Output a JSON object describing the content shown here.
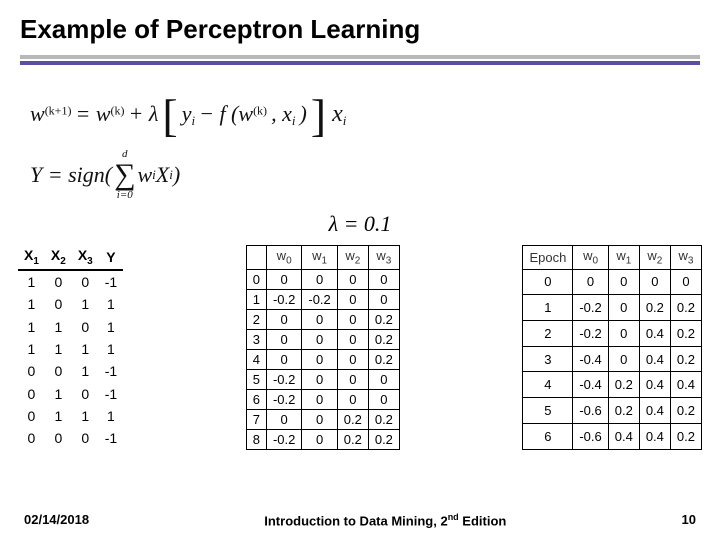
{
  "title": "Example of Perceptron Learning",
  "formula1_a": "w",
  "formula1_a_sup": "(k+1)",
  "formula1_eq": " = ",
  "formula1_b": "w",
  "formula1_b_sup": "(k)",
  "formula1_plus": " + λ",
  "formula1_inner_pre": "y",
  "formula1_inner_pre_sub": "i",
  "formula1_inner_mid": " − f (w",
  "formula1_inner_mid_sup": "(k)",
  "formula1_inner_post": ", x",
  "formula1_inner_post_sub": "i",
  "formula1_inner_close": " )",
  "formula1_tail": "x",
  "formula1_tail_sub": "i",
  "formula2_lead": "Y = sign(",
  "formula2_sum_top": "d",
  "formula2_sigma": "∑",
  "formula2_sum_bot": "i=0",
  "formula2_body_wa": "w",
  "formula2_body_wa_sub": "i",
  "formula2_body_xa": "X",
  "formula2_body_xa_sub": "i",
  "formula2_close": ")",
  "lambda_text": "λ = 0.1",
  "tbl_data": {
    "headers": [
      "X",
      "X",
      "X",
      "Y"
    ],
    "header_subs": [
      "1",
      "2",
      "3",
      ""
    ],
    "rows": [
      [
        "1",
        "0",
        "0",
        "-1"
      ],
      [
        "1",
        "0",
        "1",
        "1"
      ],
      [
        "1",
        "1",
        "0",
        "1"
      ],
      [
        "1",
        "1",
        "1",
        "1"
      ],
      [
        "0",
        "0",
        "1",
        "-1"
      ],
      [
        "0",
        "1",
        "0",
        "-1"
      ],
      [
        "0",
        "1",
        "1",
        "1"
      ],
      [
        "0",
        "0",
        "0",
        "-1"
      ]
    ]
  },
  "tbl_iter": {
    "headers": [
      "",
      "w",
      "w",
      "w",
      "w"
    ],
    "header_subs": [
      "",
      "0",
      "1",
      "2",
      "3"
    ],
    "rows": [
      [
        "0",
        "0",
        "0",
        "0",
        "0"
      ],
      [
        "1",
        "-0.2",
        "-0.2",
        "0",
        "0"
      ],
      [
        "2",
        "0",
        "0",
        "0",
        "0.2"
      ],
      [
        "3",
        "0",
        "0",
        "0",
        "0.2"
      ],
      [
        "4",
        "0",
        "0",
        "0",
        "0.2"
      ],
      [
        "5",
        "-0.2",
        "0",
        "0",
        "0"
      ],
      [
        "6",
        "-0.2",
        "0",
        "0",
        "0"
      ],
      [
        "7",
        "0",
        "0",
        "0.2",
        "0.2"
      ],
      [
        "8",
        "-0.2",
        "0",
        "0.2",
        "0.2"
      ]
    ]
  },
  "tbl_epoch": {
    "headers": [
      "Epoch",
      "w",
      "w",
      "w",
      "w"
    ],
    "header_subs": [
      "",
      "0",
      "1",
      "2",
      "3"
    ],
    "rows": [
      [
        "0",
        "0",
        "0",
        "0",
        "0"
      ],
      [
        "1",
        "-0.2",
        "0",
        "0.2",
        "0.2"
      ],
      [
        "2",
        "-0.2",
        "0",
        "0.4",
        "0.2"
      ],
      [
        "3",
        "-0.4",
        "0",
        "0.4",
        "0.2"
      ],
      [
        "4",
        "-0.4",
        "0.2",
        "0.4",
        "0.4"
      ],
      [
        "5",
        "-0.6",
        "0.2",
        "0.4",
        "0.2"
      ],
      [
        "6",
        "-0.6",
        "0.4",
        "0.4",
        "0.2"
      ]
    ]
  },
  "footer": {
    "date": "02/14/2018",
    "center_a": "Introduction to Data Mining, 2",
    "center_sup": "nd",
    "center_b": " Edition",
    "page": "10"
  }
}
